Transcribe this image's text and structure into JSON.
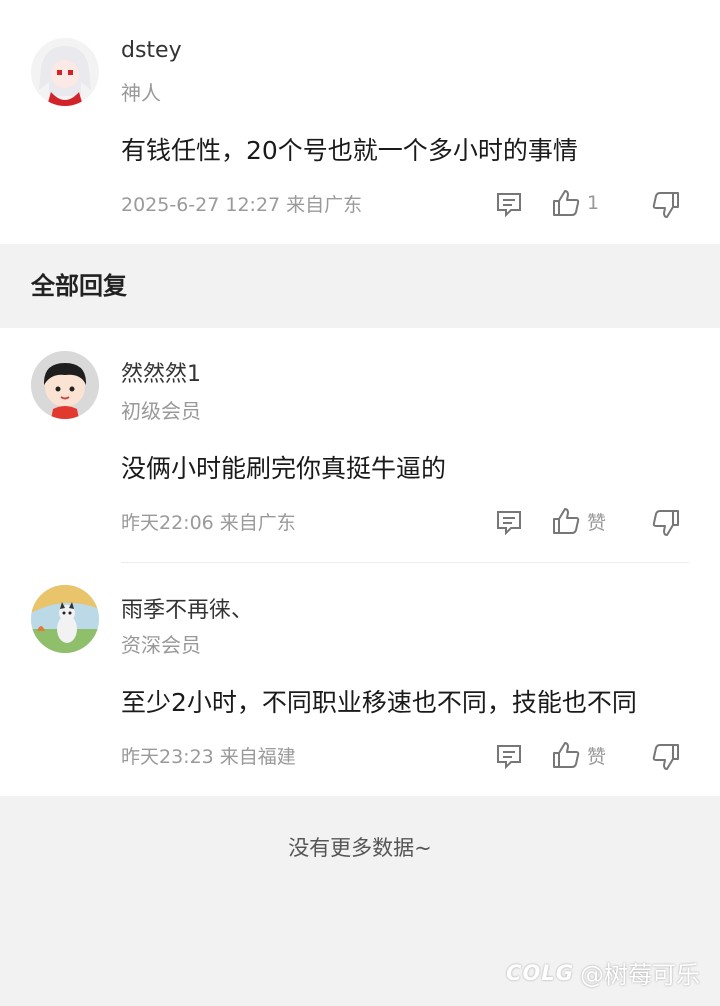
{
  "top_comment": {
    "username": "dstey",
    "level": "神人",
    "content": "有钱任性，20个号也就一个多小时的事情",
    "meta": "2025-6-27 12:27  来自广东",
    "like_count": "1"
  },
  "section_title": "全部回复",
  "replies": [
    {
      "username": "然然然1",
      "level": "初级会员",
      "content": "没俩小时能刷完你真挺牛逼的",
      "meta": "昨天22:06 来自广东",
      "like_label": "赞"
    },
    {
      "username": "雨季不再徕、",
      "level": "资深会员",
      "content": "至少2小时，不同职业移速也不同，技能也不同",
      "meta": "昨天23:23 来自福建",
      "like_label": "赞"
    }
  ],
  "no_more": "没有更多数据~",
  "watermark": {
    "logo": "COLG",
    "handle": "@树莓可乐"
  }
}
